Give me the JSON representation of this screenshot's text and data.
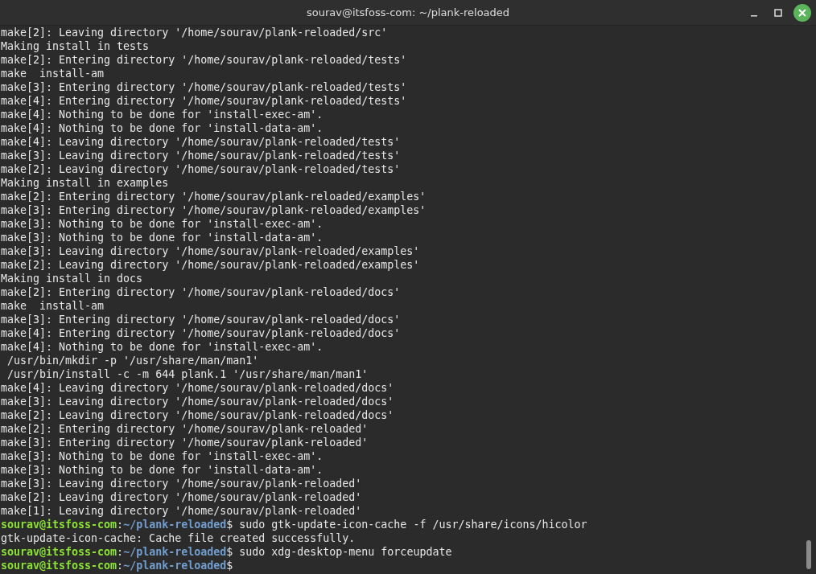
{
  "window": {
    "title": "sourav@itsfoss-com: ~/plank-reloaded"
  },
  "lines": [
    {
      "kind": "output",
      "text": "make[2]: Leaving directory '/home/sourav/plank-reloaded/src'"
    },
    {
      "kind": "output",
      "text": "Making install in tests"
    },
    {
      "kind": "output",
      "text": "make[2]: Entering directory '/home/sourav/plank-reloaded/tests'"
    },
    {
      "kind": "output",
      "text": "make  install-am"
    },
    {
      "kind": "output",
      "text": "make[3]: Entering directory '/home/sourav/plank-reloaded/tests'"
    },
    {
      "kind": "output",
      "text": "make[4]: Entering directory '/home/sourav/plank-reloaded/tests'"
    },
    {
      "kind": "output",
      "text": "make[4]: Nothing to be done for 'install-exec-am'."
    },
    {
      "kind": "output",
      "text": "make[4]: Nothing to be done for 'install-data-am'."
    },
    {
      "kind": "output",
      "text": "make[4]: Leaving directory '/home/sourav/plank-reloaded/tests'"
    },
    {
      "kind": "output",
      "text": "make[3]: Leaving directory '/home/sourav/plank-reloaded/tests'"
    },
    {
      "kind": "output",
      "text": "make[2]: Leaving directory '/home/sourav/plank-reloaded/tests'"
    },
    {
      "kind": "output",
      "text": "Making install in examples"
    },
    {
      "kind": "output",
      "text": "make[2]: Entering directory '/home/sourav/plank-reloaded/examples'"
    },
    {
      "kind": "output",
      "text": "make[3]: Entering directory '/home/sourav/plank-reloaded/examples'"
    },
    {
      "kind": "output",
      "text": "make[3]: Nothing to be done for 'install-exec-am'."
    },
    {
      "kind": "output",
      "text": "make[3]: Nothing to be done for 'install-data-am'."
    },
    {
      "kind": "output",
      "text": "make[3]: Leaving directory '/home/sourav/plank-reloaded/examples'"
    },
    {
      "kind": "output",
      "text": "make[2]: Leaving directory '/home/sourav/plank-reloaded/examples'"
    },
    {
      "kind": "output",
      "text": "Making install in docs"
    },
    {
      "kind": "output",
      "text": "make[2]: Entering directory '/home/sourav/plank-reloaded/docs'"
    },
    {
      "kind": "output",
      "text": "make  install-am"
    },
    {
      "kind": "output",
      "text": "make[3]: Entering directory '/home/sourav/plank-reloaded/docs'"
    },
    {
      "kind": "output",
      "text": "make[4]: Entering directory '/home/sourav/plank-reloaded/docs'"
    },
    {
      "kind": "output",
      "text": "make[4]: Nothing to be done for 'install-exec-am'."
    },
    {
      "kind": "output",
      "text": " /usr/bin/mkdir -p '/usr/share/man/man1'"
    },
    {
      "kind": "output",
      "text": " /usr/bin/install -c -m 644 plank.1 '/usr/share/man/man1'"
    },
    {
      "kind": "output",
      "text": "make[4]: Leaving directory '/home/sourav/plank-reloaded/docs'"
    },
    {
      "kind": "output",
      "text": "make[3]: Leaving directory '/home/sourav/plank-reloaded/docs'"
    },
    {
      "kind": "output",
      "text": "make[2]: Leaving directory '/home/sourav/plank-reloaded/docs'"
    },
    {
      "kind": "output",
      "text": "make[2]: Entering directory '/home/sourav/plank-reloaded'"
    },
    {
      "kind": "output",
      "text": "make[3]: Entering directory '/home/sourav/plank-reloaded'"
    },
    {
      "kind": "output",
      "text": "make[3]: Nothing to be done for 'install-exec-am'."
    },
    {
      "kind": "output",
      "text": "make[3]: Nothing to be done for 'install-data-am'."
    },
    {
      "kind": "output",
      "text": "make[3]: Leaving directory '/home/sourav/plank-reloaded'"
    },
    {
      "kind": "output",
      "text": "make[2]: Leaving directory '/home/sourav/plank-reloaded'"
    },
    {
      "kind": "output",
      "text": "make[1]: Leaving directory '/home/sourav/plank-reloaded'"
    },
    {
      "kind": "prompt",
      "user": "sourav@itsfoss-com",
      "sep": ":",
      "path": "~/plank-reloaded",
      "symbol": "$",
      "command": "sudo gtk-update-icon-cache -f /usr/share/icons/hicolor"
    },
    {
      "kind": "output",
      "text": "gtk-update-icon-cache: Cache file created successfully."
    },
    {
      "kind": "prompt",
      "user": "sourav@itsfoss-com",
      "sep": ":",
      "path": "~/plank-reloaded",
      "symbol": "$",
      "command": "sudo xdg-desktop-menu forceupdate"
    },
    {
      "kind": "prompt",
      "user": "sourav@itsfoss-com",
      "sep": ":",
      "path": "~/plank-reloaded",
      "symbol": "$"
    }
  ]
}
